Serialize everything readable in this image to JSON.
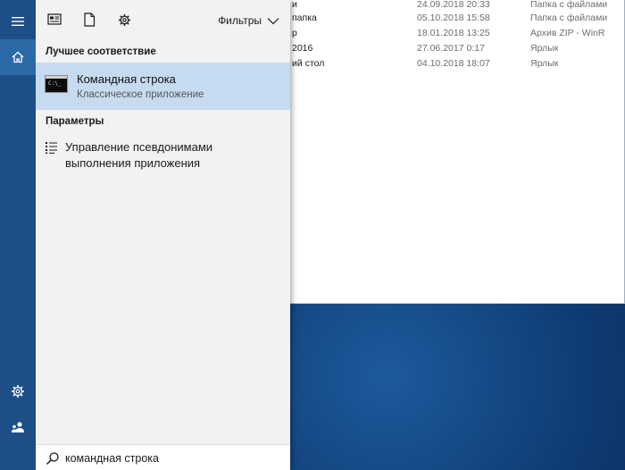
{
  "explorer": {
    "rows": [
      {
        "name": "и",
        "date": "24.09.2018 20:33",
        "type": "Папка с файлами"
      },
      {
        "name": "папка",
        "date": "05.10.2018 15:58",
        "type": "Папка с файлами"
      },
      {
        "name": "р",
        "date": "18.01.2018 13:25",
        "type": "Архив ZIP - WinR"
      },
      {
        "name": "2016",
        "date": "27.06.2017 0:17",
        "type": "Ярлык"
      },
      {
        "name": "ий стол",
        "date": "04.10.2018 18:07",
        "type": "Ярлык"
      }
    ]
  },
  "start_menu": {
    "rail": {
      "menu_icon": "hamburger-icon",
      "home_icon": "home-icon",
      "settings_icon": "gear-icon",
      "user_icon": "user-icon"
    },
    "top_bar": {
      "icons": [
        "apps-icon",
        "document-icon",
        "gear-icon"
      ],
      "filters_label": "Фильтры"
    },
    "best_match": {
      "header": "Лучшее соответствие",
      "title": "Командная строка",
      "subtitle": "Классическое приложение"
    },
    "settings": {
      "header": "Параметры",
      "item": "Управление псевдонимами выполнения приложения"
    },
    "search": {
      "value": "командная строка"
    }
  },
  "colors": {
    "rail_bg": "#1e4e86",
    "rail_active": "#2b6aa6",
    "panel_bg": "#f2f2f2",
    "highlight": "#c6dbef"
  }
}
